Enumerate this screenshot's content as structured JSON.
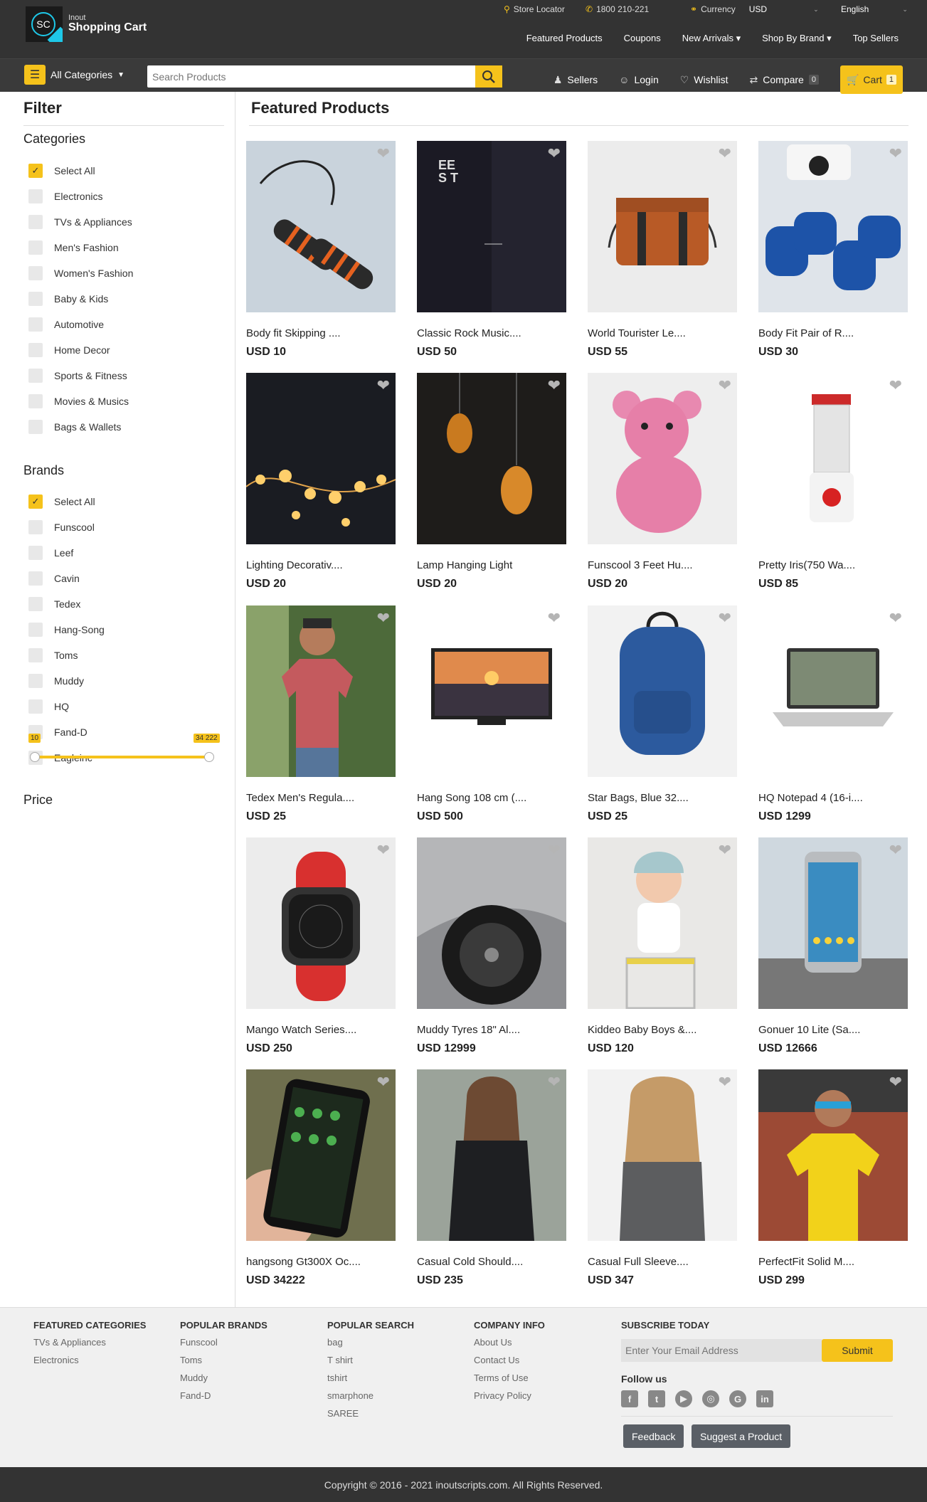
{
  "header": {
    "logo_small": "Inout",
    "logo_big": "Shopping Cart",
    "logo_mark": "SC",
    "store_locator": "Store Locator",
    "phone": "1800 210-221",
    "currency_label": "Currency",
    "currency_value": "USD",
    "language": "English",
    "nav": [
      "Featured Products",
      "Coupons",
      "New Arrivals ▾",
      "Shop By Brand ▾",
      "Top Sellers"
    ]
  },
  "search": {
    "categories_label": "All Categories",
    "placeholder": "Search Products",
    "sellers": "Sellers",
    "login": "Login",
    "wishlist": "Wishlist",
    "compare": "Compare",
    "compare_count": "0",
    "cart": "Cart",
    "cart_count": "1"
  },
  "sidebar": {
    "title": "Filter",
    "categories_title": "Categories",
    "categories": [
      {
        "label": "Select All",
        "checked": true
      },
      {
        "label": "Electronics",
        "checked": false
      },
      {
        "label": "TVs & Appliances",
        "checked": false
      },
      {
        "label": "Men's Fashion",
        "checked": false
      },
      {
        "label": "Women's Fashion",
        "checked": false
      },
      {
        "label": "Baby & Kids",
        "checked": false
      },
      {
        "label": "Automotive",
        "checked": false
      },
      {
        "label": "Home Decor",
        "checked": false
      },
      {
        "label": "Sports & Fitness",
        "checked": false
      },
      {
        "label": "Movies & Musics",
        "checked": false
      },
      {
        "label": "Bags & Wallets",
        "checked": false
      }
    ],
    "brands_title": "Brands",
    "brands": [
      {
        "label": "Select All",
        "checked": true
      },
      {
        "label": "Funscool",
        "checked": false
      },
      {
        "label": "Leef",
        "checked": false
      },
      {
        "label": "Cavin",
        "checked": false
      },
      {
        "label": "Tedex",
        "checked": false
      },
      {
        "label": "Hang-Song",
        "checked": false
      },
      {
        "label": "Toms",
        "checked": false
      },
      {
        "label": "Muddy",
        "checked": false
      },
      {
        "label": "HQ",
        "checked": false
      },
      {
        "label": "Fand-D",
        "checked": false
      },
      {
        "label": "Eagleinc",
        "checked": false
      }
    ],
    "price_title": "Price",
    "price_min": "10",
    "price_max": "34 222"
  },
  "main": {
    "title": "Featured Products",
    "products": [
      {
        "name": "Body fit Skipping ....",
        "price": "USD 10",
        "icon": "skipping-rope"
      },
      {
        "name": "Classic Rock Music....",
        "price": "USD 50",
        "icon": "poster"
      },
      {
        "name": "World Tourister Le....",
        "price": "USD 55",
        "icon": "bag"
      },
      {
        "name": "Body Fit Pair of R....",
        "price": "USD 30",
        "icon": "dumbbells"
      },
      {
        "name": "Lighting Decorativ....",
        "price": "USD 20",
        "icon": "lights"
      },
      {
        "name": "Lamp Hanging Light",
        "price": "USD 20",
        "icon": "lamp"
      },
      {
        "name": "Funscool 3 Feet Hu....",
        "price": "USD 20",
        "icon": "teddy"
      },
      {
        "name": "Pretty Iris(750 Wa....",
        "price": "USD 85",
        "icon": "blender"
      },
      {
        "name": "Tedex Men's Regula....",
        "price": "USD 25",
        "icon": "tshirt-man"
      },
      {
        "name": "Hang Song 108 cm (....",
        "price": "USD 500",
        "icon": "tv"
      },
      {
        "name": "Star Bags, Blue 32....",
        "price": "USD 25",
        "icon": "backpack"
      },
      {
        "name": "HQ Notepad 4 (16-i....",
        "price": "USD 1299",
        "icon": "laptop"
      },
      {
        "name": "Mango Watch Series....",
        "price": "USD 250",
        "icon": "watch"
      },
      {
        "name": "Muddy Tyres 18\" Al....",
        "price": "USD 12999",
        "icon": "tyre"
      },
      {
        "name": "Kiddeo Baby Boys &....",
        "price": "USD 120",
        "icon": "baby"
      },
      {
        "name": "Gonuer 10 Lite (Sa....",
        "price": "USD 12666",
        "icon": "phone"
      },
      {
        "name": "hangsong Gt300X Oc....",
        "price": "USD 34222",
        "icon": "phone-hand"
      },
      {
        "name": "Casual Cold Should....",
        "price": "USD 235",
        "icon": "coat-woman"
      },
      {
        "name": "Casual Full Sleeve....",
        "price": "USD 347",
        "icon": "woman-tee"
      },
      {
        "name": "PerfectFit Solid M....",
        "price": "USD 299",
        "icon": "yellow-tee"
      }
    ]
  },
  "footer": {
    "featured_title": "FEATURED CATEGORIES",
    "featured": [
      "TVs & Appliances",
      "Electronics"
    ],
    "brands_title": "POPULAR BRANDS",
    "brands": [
      "Funscool",
      "Toms",
      "Muddy",
      "Fand-D"
    ],
    "search_title": "POPULAR SEARCH",
    "searches": [
      "bag",
      "T shirt",
      "tshirt",
      "smarphone",
      "SAREE"
    ],
    "company_title": "COMPANY INFO",
    "company": [
      "About Us",
      "Contact Us",
      "Terms of Use",
      "Privacy Policy"
    ],
    "subscribe_title": "SUBSCRIBE TODAY",
    "email_placeholder": "Enter Your Email Address",
    "submit": "Submit",
    "follow": "Follow us",
    "feedback": "Feedback",
    "suggest": "Suggest a Product",
    "copyright": "Copyright © 2016 - 2021 inoutscripts.com. All Rights Reserved."
  },
  "colors": {
    "accent": "#f5c21b",
    "header_bg": "#333333",
    "footer_bg": "#f0f0f0"
  }
}
